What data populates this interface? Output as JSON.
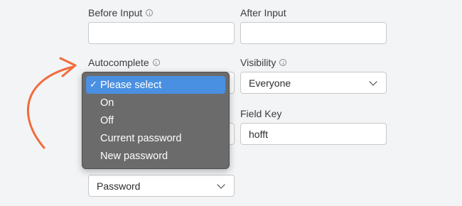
{
  "fields": {
    "before_input": {
      "label": "Before Input",
      "value": ""
    },
    "after_input": {
      "label": "After Input",
      "value": ""
    },
    "autocomplete": {
      "label": "Autocomplete"
    },
    "visibility": {
      "label": "Visibility",
      "value": "Everyone"
    },
    "field_key": {
      "label": "Field Key",
      "value": "hofft"
    },
    "type": {
      "value": "Password"
    }
  },
  "dropdown": {
    "options": [
      "Please select",
      "On",
      "Off",
      "Current password",
      "New password"
    ],
    "selected_index": 0,
    "check_mark": "✓"
  },
  "colors": {
    "dropdown_bg": "#6b6b6b",
    "selected_bg": "#4a90e2",
    "arrow": "#f26b3a"
  }
}
